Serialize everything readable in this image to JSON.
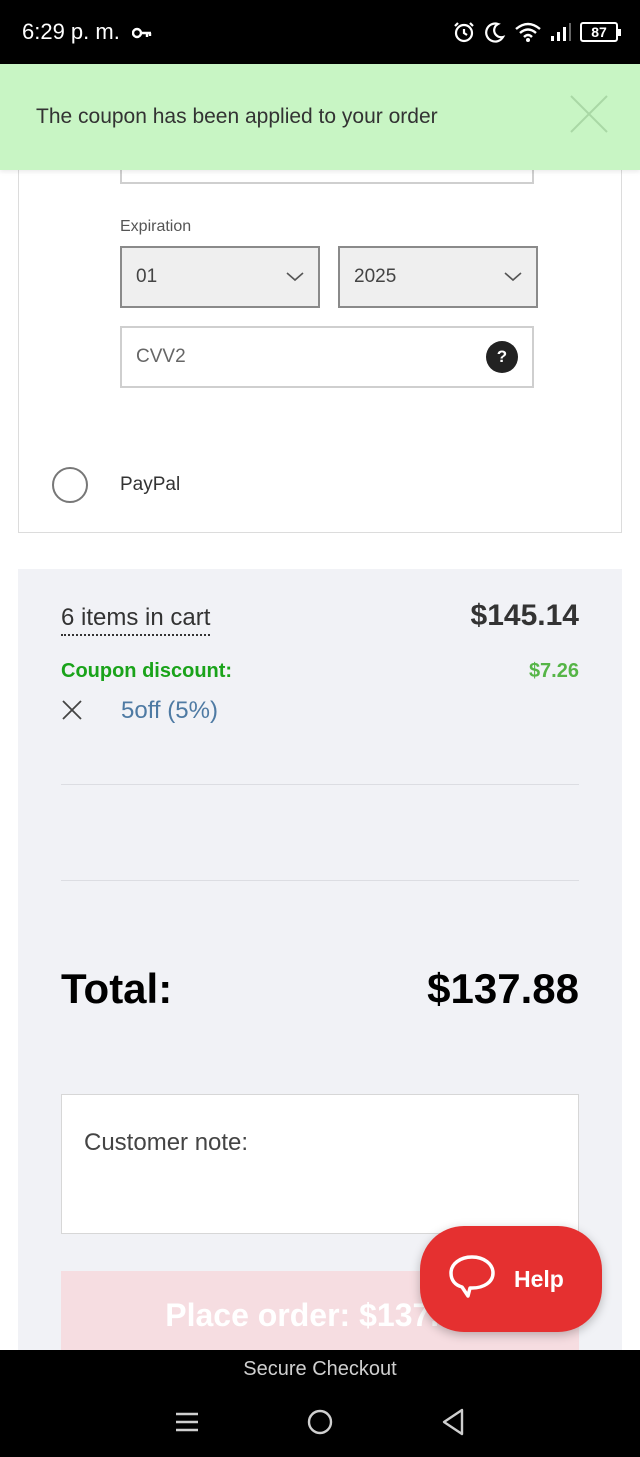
{
  "status_bar": {
    "time": "6:29 p. m.",
    "battery": "87"
  },
  "toast": {
    "message": "The coupon has been applied to your order"
  },
  "payment": {
    "expiration_label": "Expiration",
    "month_value": "01",
    "year_value": "2025",
    "cvv_placeholder": "CVV2",
    "cvv_help": "?",
    "paypal_label": "PayPal"
  },
  "summary": {
    "items_link": "6 items in cart",
    "subtotal": "$145.14",
    "coupon_label": "Coupon discount:",
    "coupon_value": "$7.26",
    "coupon_code": "5off (5%)",
    "total_label": "Total:",
    "total_value": "$137.88",
    "customer_note_label": "Customer note:",
    "place_order": "Place order: $137.88"
  },
  "help_button": {
    "label": "Help"
  },
  "footer": {
    "secure_text": "Secure Checkout"
  },
  "colors": {
    "toast_bg": "#c8f5c4",
    "coupon_green": "#1aa31a",
    "coupon_code_blue": "#4e7aa3",
    "help_red": "#e53030",
    "summary_bg": "#f1f2f6"
  }
}
